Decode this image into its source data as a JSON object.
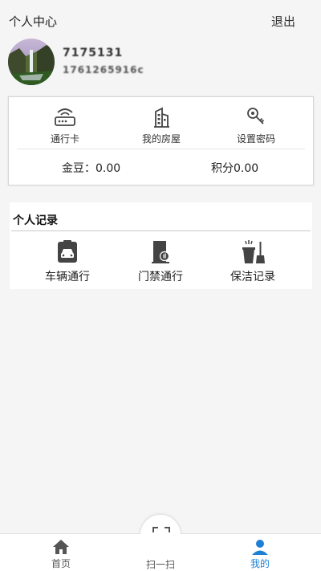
{
  "header": {
    "title": "个人中心",
    "logout_label": "退出"
  },
  "profile": {
    "name": "7175131",
    "phone": "1761265916c",
    "avatar_icon": "avatar-waterfall-photo"
  },
  "services": [
    {
      "label": "通行卡",
      "icon": "router-card-icon"
    },
    {
      "label": "我的房屋",
      "icon": "building-icon"
    },
    {
      "label": "设置密码",
      "icon": "key-icon"
    }
  ],
  "stats": {
    "gold": "金豆：0.00",
    "points": "积分0.00"
  },
  "records": {
    "title": "个人记录",
    "items": [
      {
        "label": "车辆通行",
        "icon": "car-icon"
      },
      {
        "label": "门禁通行",
        "icon": "door-icon"
      },
      {
        "label": "保洁记录",
        "icon": "cleaning-icon"
      }
    ]
  },
  "tabbar": {
    "home_label": "首页",
    "scan_label": "扫一扫",
    "mine_label": "我的",
    "active_color": "#1e7fd6",
    "icon_color": "#555555"
  }
}
